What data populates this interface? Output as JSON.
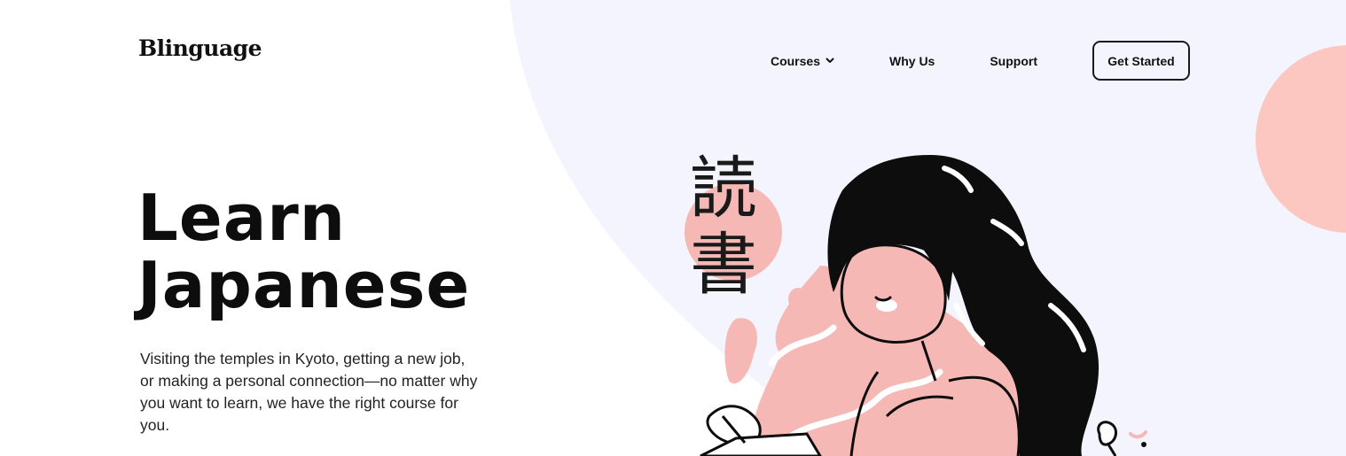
{
  "header": {
    "logo": "Blinguage",
    "nav": {
      "courses": "Courses",
      "why_us": "Why Us",
      "support": "Support"
    },
    "cta": "Get Started"
  },
  "hero": {
    "title_line1": "Learn",
    "title_line2": "Japanese",
    "description": "Visiting the temples in Kyoto, getting a new job, or making a personal connection—no matter why you want to learn, we have the right course for you."
  },
  "illustration": {
    "kanji_top": "読",
    "kanji_bottom": "書"
  },
  "colors": {
    "blob_lavender": "#f4f4fe",
    "accent_pink": "#f6b8b5",
    "corner_pink": "#fcc7c0",
    "ink": "#111111"
  },
  "icons": [
    "chevron-down-icon"
  ]
}
